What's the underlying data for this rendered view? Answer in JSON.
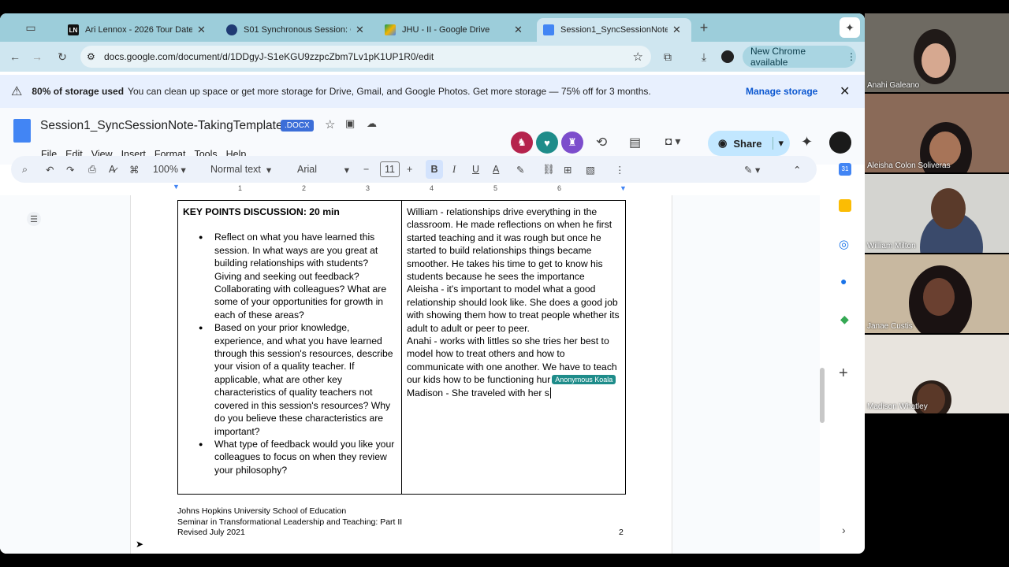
{
  "tabs": [
    {
      "title": "Ari Lennox - 2026 Tour Dates",
      "fav": "LN",
      "color": "#111111"
    },
    {
      "title": "S01 Synchronous Session: Q",
      "fav": "",
      "color": "#1f3a73"
    },
    {
      "title": "JHU - II - Google Drive",
      "fav": "",
      "color": "#f4b400"
    },
    {
      "title": "Session1_SyncSessionNote-",
      "fav": "",
      "color": "#4285f4"
    }
  ],
  "url": "docs.google.com/document/d/1DDgyJ-S1eKGU9zzpcZbm7Lv1pK1UP1R0/edit",
  "chrome_update": "New Chrome available",
  "banner": {
    "bold": "80% of storage used",
    "text": "You can clean up space or get more storage for Drive, Gmail, and Google Photos. Get more storage — 75% off for 3 months.",
    "action": "Manage storage"
  },
  "doc": {
    "title": "Session1_SyncSessionNote-TakingTemplate",
    "badge": ".DOCX",
    "share": "Share"
  },
  "menu": [
    "File",
    "Edit",
    "View",
    "Insert",
    "Format",
    "Tools",
    "Help"
  ],
  "format": {
    "zoom": "100%",
    "style": "Normal text",
    "font": "Arial",
    "size": "11"
  },
  "ruler": [
    "1",
    "2",
    "3",
    "4",
    "5",
    "6",
    "7"
  ],
  "left_cell": {
    "heading": "KEY POINTS DISCUSSION:  20 min",
    "bullets": [
      "Reflect on what you have learned this session. In what ways are you great at building relationships with students? Giving and seeking out feedback? Collaborating with colleagues? What are some of your opportunities for growth in each of these areas?",
      "Based on your prior knowledge, experience, and what you have learned through this session's resources, describe your vision of a quality teacher. If applicable, what are other key characteristics of quality teachers not covered in this session's resources? Why do you believe these characteristics are important?",
      "What type of feedback would you like your colleagues to focus on when they review your philosophy?"
    ]
  },
  "right_cell": {
    "p1": "William - relationships drive everything in the classroom. He made reflections on when he first started teaching and it was rough but once he started to build relationships things became smoother. He takes his time to get to know his students because he sees the importance",
    "p2": "Aleisha - it's important to model what a good relationship should look like. She does a good job with showing them how to treat people whether its adult to adult or peer to peer.",
    "p3": "Anahi - works with littles so she tries her best to model how to treat others and how to communicate with one another. We have to teach our kids how to be functioning hur",
    "cursor_label": "Anonymous Koala",
    "p4": "Madison - She traveled with her s"
  },
  "footer": {
    "line1": "Johns Hopkins University School of Education",
    "line2": "Seminar in Transformational Leadership and Teaching: Part II",
    "line3": "Revised July 2021",
    "page": "2"
  },
  "participants": [
    "Anahi Galeano",
    "Aleisha Colon Soliveras",
    "William Milton",
    "Janae Custis",
    "Madison Whatley"
  ]
}
